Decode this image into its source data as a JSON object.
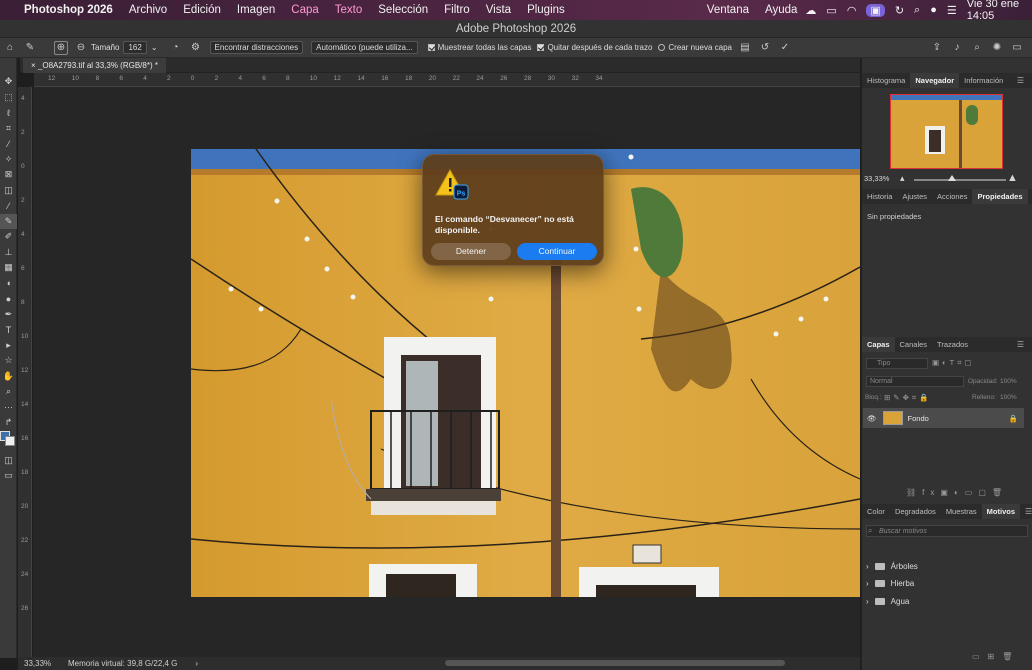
{
  "menubar": {
    "app": "Photoshop 2026",
    "items": [
      "Archivo",
      "Edición",
      "Imagen",
      "Capa",
      "Texto",
      "Selección",
      "Filtro",
      "Vista",
      "Plugins",
      "Ventana",
      "Ayuda"
    ],
    "clock": "Vie 30 ene  14:05"
  },
  "window": {
    "title": "Adobe Photoshop 2026"
  },
  "options": {
    "size_label": "Tamaño",
    "size_value": "162",
    "find_distractions": "Encontrar distracciones",
    "mode": "Automático (puede utiliza...",
    "sample_all": "Muestrear todas las capas",
    "remove_after": "Quitar después de cada trazo",
    "new_layer": "Crear nueva capa"
  },
  "document": {
    "tab": "_O8A2793.tif al 33,3% (RGB/8*) *"
  },
  "ruler": {
    "h_ticks": [
      "12",
      "10",
      "8",
      "6",
      "4",
      "2",
      "0",
      "2",
      "4",
      "6",
      "8",
      "10",
      "12",
      "14",
      "16",
      "18",
      "20",
      "22",
      "24",
      "26",
      "28",
      "30",
      "32",
      "34"
    ],
    "v_ticks": [
      "4",
      "2",
      "0",
      "2",
      "4",
      "6",
      "8",
      "10",
      "12",
      "14",
      "16",
      "18",
      "20",
      "22",
      "24",
      "26"
    ]
  },
  "status": {
    "zoom": "33,33%",
    "memory": "Memoria virtual: 39,8 G/22,4 G"
  },
  "dialog": {
    "message": "El comando “Desvanecer” no está disponible.",
    "stop_label": "Detener",
    "continue_label": "Continuar"
  },
  "panels": {
    "top_tabs": [
      "Histograma",
      "Navegador",
      "Información"
    ],
    "nav_zoom": "33,33%",
    "mid_tabs": [
      "Historia",
      "Ajustes",
      "Acciones",
      "Propiedades"
    ],
    "properties_text": "Sin propiedades",
    "layer_tabs": [
      "Capas",
      "Canales",
      "Trazados"
    ],
    "filter_placeholder": "Tipo",
    "blend_mode": "Normal",
    "opacity_label": "Opacidad:",
    "opacity_value": "100%",
    "lock_label": "Bloq.:",
    "fill_label": "Relleno:",
    "fill_value": "100%",
    "layer_name": "Fondo",
    "bottom_tabs": [
      "Color",
      "Degradados",
      "Muestras",
      "Motivos"
    ],
    "search_placeholder": "Buscar motivos",
    "folders": [
      "Árboles",
      "Hierba",
      "Agua"
    ]
  },
  "colors": {
    "accent": "#1a7cf0",
    "wall": "#d9a33a",
    "sky": "#3d6fb5"
  }
}
